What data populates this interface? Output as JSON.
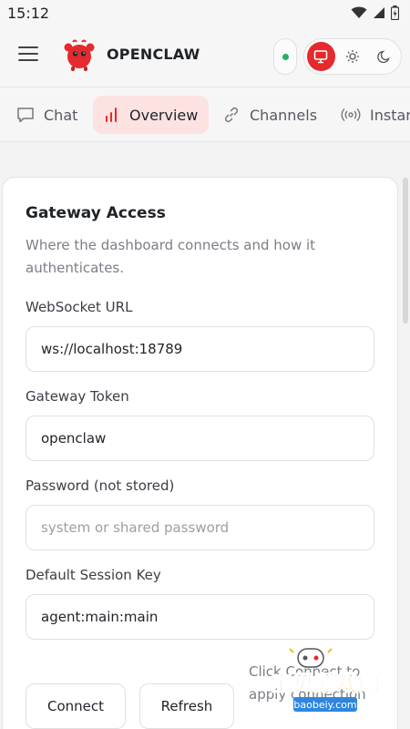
{
  "status_bar": {
    "time": "15:12",
    "icons": [
      "wifi-icon",
      "signal-icon",
      "battery-icon"
    ]
  },
  "header": {
    "menu_icon": "hamburger-menu-icon",
    "logo_icon": "red-crab-logo",
    "brand": "OPENCLAW",
    "connection_status": "connected",
    "theme_options": [
      "system",
      "light",
      "dark"
    ],
    "theme_selected": "system",
    "accent_color": "#e5292c",
    "status_color": "#22b35c"
  },
  "tabs": [
    {
      "label": "Chat",
      "icon": "chat-bubble-icon",
      "active": false
    },
    {
      "label": "Overview",
      "icon": "bar-chart-icon",
      "active": true
    },
    {
      "label": "Channels",
      "icon": "link-icon",
      "active": false
    },
    {
      "label": "Instar",
      "icon": "broadcast-icon",
      "active": false
    }
  ],
  "card": {
    "title": "Gateway Access",
    "description": "Where the dashboard connects and how it authenticates.",
    "fields": {
      "websocket_url": {
        "label": "WebSocket URL",
        "value": "ws://localhost:18789"
      },
      "gateway_token": {
        "label": "Gateway Token",
        "value": "openclaw"
      },
      "password": {
        "label": "Password (not stored)",
        "value": "",
        "placeholder": "system or shared password"
      },
      "session_key": {
        "label": "Default Session Key",
        "value": "agent:main:main"
      }
    },
    "buttons": {
      "connect": "Connect",
      "refresh": "Refresh"
    },
    "hint": "Click Connect to apply connection"
  },
  "watermark": {
    "text": "宝贝游戏网",
    "url": "baobeiy.com"
  }
}
